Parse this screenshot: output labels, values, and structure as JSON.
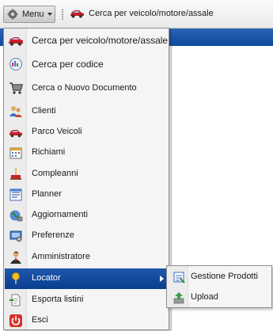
{
  "toolbar": {
    "menu_label": "Menu",
    "shortcut_label": "Cerca per veicolo/motore/assale"
  },
  "menu": {
    "items": [
      {
        "label": "Cerca per veicolo/motore/assale",
        "icon": "car-search-icon"
      },
      {
        "label": "Cerca per codice",
        "icon": "code-search-icon"
      },
      {
        "label": "Cerca o Nuovo Documento",
        "icon": "cart-icon"
      },
      {
        "label": "Clienti",
        "icon": "customers-icon"
      },
      {
        "label": "Parco Veicoli",
        "icon": "vehicle-fleet-icon"
      },
      {
        "label": "Richiami",
        "icon": "recall-calendar-icon"
      },
      {
        "label": "Compleanni",
        "icon": "birthday-cake-icon"
      },
      {
        "label": "Planner",
        "icon": "planner-icon"
      },
      {
        "label": "Aggiornamenti",
        "icon": "updates-globe-icon"
      },
      {
        "label": "Preferenze",
        "icon": "preferences-icon"
      },
      {
        "label": "Amministratore",
        "icon": "administrator-icon"
      },
      {
        "label": "Locator",
        "icon": "locator-pin-icon"
      },
      {
        "label": "Esporta listini",
        "icon": "export-document-icon"
      },
      {
        "label": "Esci",
        "icon": "power-icon"
      }
    ]
  },
  "submenu": {
    "items": [
      {
        "label": "Gestione Prodotti",
        "icon": "product-management-icon"
      },
      {
        "label": "Upload",
        "icon": "upload-icon"
      }
    ]
  },
  "colors": {
    "selection": "#1f57ab",
    "menu_background": "#f5f5f5",
    "header_strip": "#2b63b6"
  }
}
